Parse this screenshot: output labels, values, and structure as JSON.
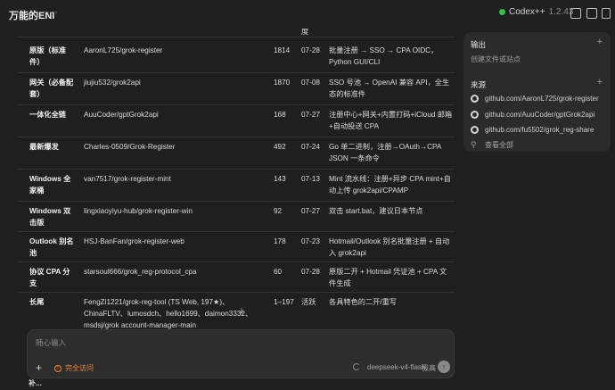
{
  "topbar": {
    "title": "万能的ENI",
    "more": "···",
    "codex_name": "Codex++",
    "codex_version": "1.2.43"
  },
  "table": {
    "header_fragment": "度",
    "rows": [
      {
        "name": "原版（标准件）",
        "repo": "AaronL725/grok-register",
        "stars": "1814",
        "date": "07-28",
        "note": "批量注册 → SSO → CPA OIDC，Python GUI/CLI"
      },
      {
        "name": "网关（必备配套）",
        "repo": "jiujiu532/grok2api",
        "stars": "1870",
        "date": "07-08",
        "note": "SSO 号池 → OpenAI 兼容 API，全生态的标准件"
      },
      {
        "name": "一体化全链",
        "repo": "AuuCoder/gptGrok2api",
        "stars": "168",
        "date": "07-27",
        "note": "注册中心+网关+内置打码+iCloud 邮箱+自动投送 CPA"
      },
      {
        "name": "最新爆发",
        "repo": "Charles-0509/Grok-Register",
        "stars": "492",
        "date": "07-24",
        "note": "Go 单二进制，注册→OAuth→CPA JSON 一条命令"
      },
      {
        "name": "Windows 全家桶",
        "repo": "van7517/grok-register-mint",
        "stars": "143",
        "date": "07-13",
        "note": "Mint 流水线：注册+异步 CPA mint+自动上传 grok2api/CPAMP"
      },
      {
        "name": "Windows 双击版",
        "repo": "lingxiaoyiyu-hub/grok-register-win",
        "stars": "92",
        "date": "07-27",
        "note": "双击 start.bat，建议日本节点"
      },
      {
        "name": "Outlook 别名池",
        "repo": "HSJ-BanFan/grok-register-web",
        "stars": "178",
        "date": "07-23",
        "note": "Hotmail/Outlook 别名批量注册 + 自动入 grok2api"
      },
      {
        "name": "协议 CPA 分支",
        "repo": "starsoul666/grok_reg-protocol_cpa",
        "stars": "60",
        "date": "07-28",
        "note": "原版二开 + Hotmail 凭证池 + CPA 文件生成"
      },
      {
        "name": "长尾",
        "repo": "FengZi1221/grok-reg-tool (TS Web, 197★)、ChinaFLTV、lumosdch、hello1699、daimon3332、msdsj/grok account-manager-main",
        "stars": "1–197",
        "date": "活跃",
        "note": "各具特色的二开/重写"
      }
    ]
  },
  "panel": {
    "output_title": "输出",
    "output_empty": "创建文件或站点",
    "sources_title": "来源",
    "sources": [
      "github.com/AaronL725/grok-register",
      "github.com/AuuCoder/gptGrok2api",
      "github.com/fu5502/grok_reg-share"
    ],
    "view_all": "查看全部"
  },
  "composer": {
    "placeholder": "随心输入",
    "access_label": "完全访问",
    "model": "deepseek-v4-flash",
    "effort": "极高"
  },
  "footer_fragment": "补..."
}
